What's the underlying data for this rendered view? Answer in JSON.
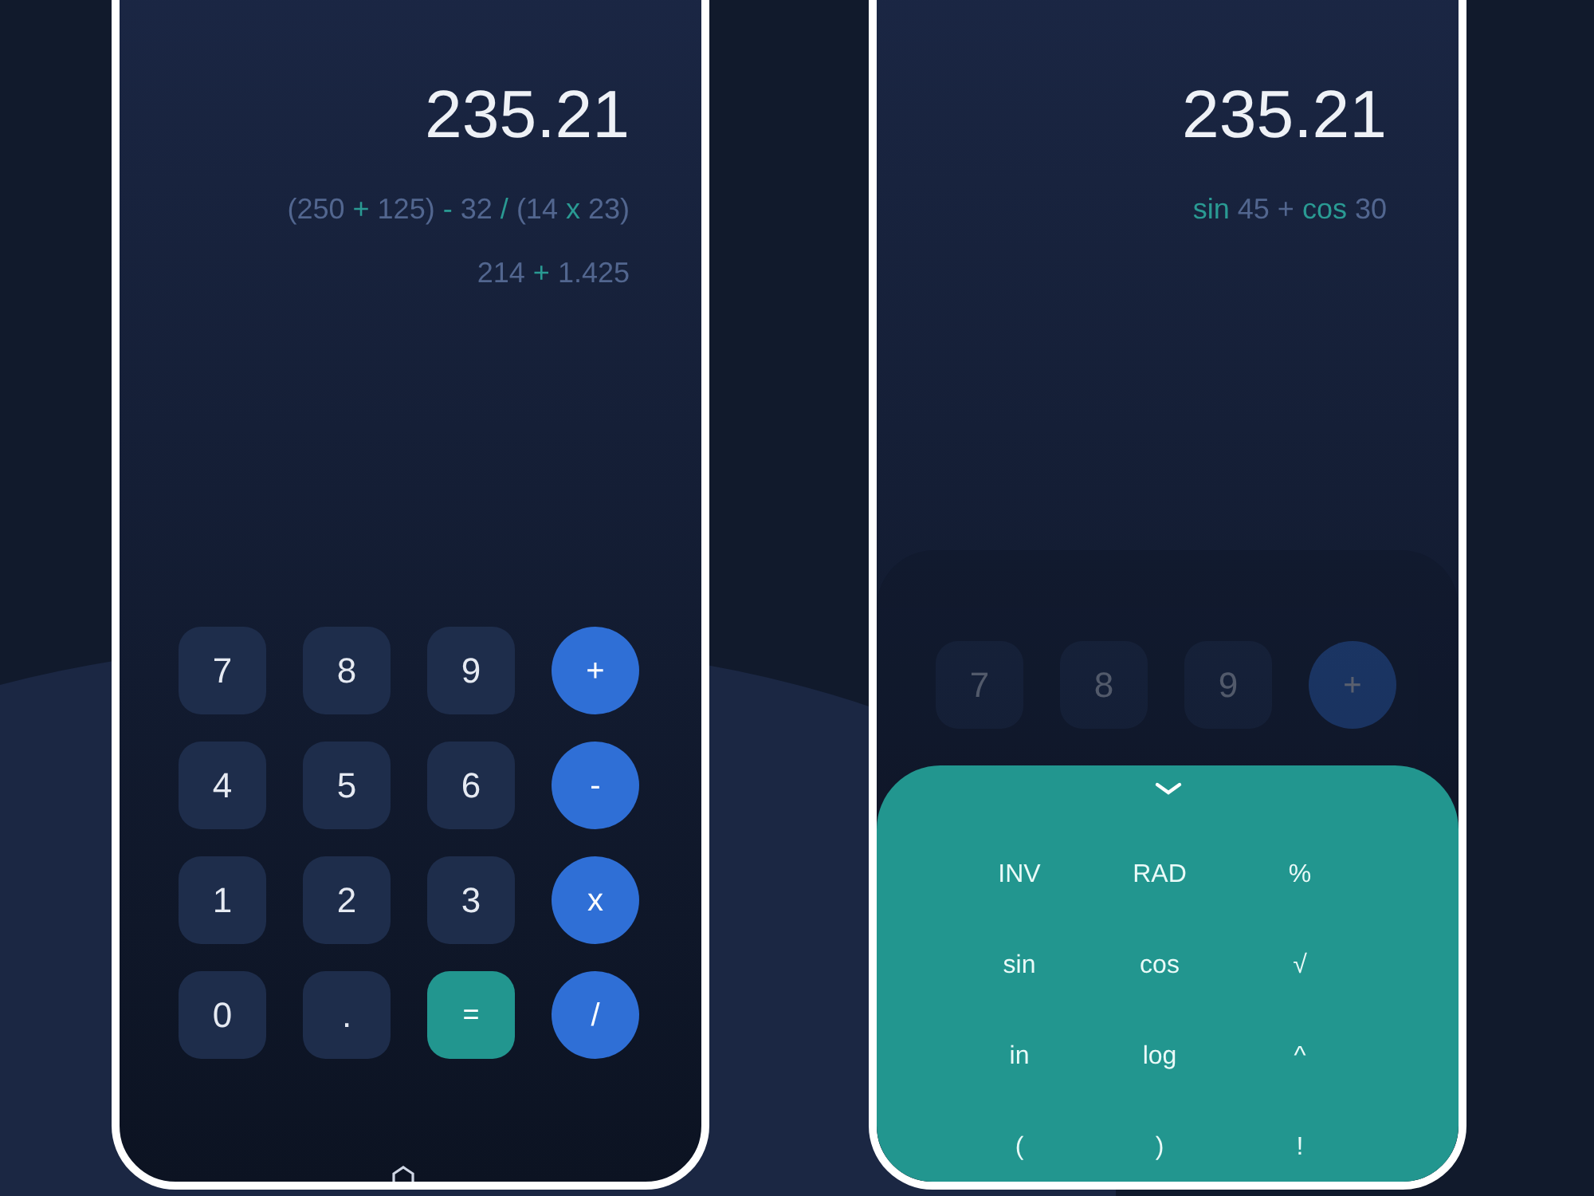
{
  "screens": [
    {
      "result": "235.21",
      "keypad_dimmed": false,
      "expressions": [
        {
          "tokens": [
            {
              "text": "(250",
              "kind": "plain"
            },
            {
              "text": "+",
              "kind": "accent"
            },
            {
              "text": "125)",
              "kind": "plain"
            },
            {
              "text": "-",
              "kind": "accent"
            },
            {
              "text": "32",
              "kind": "plain"
            },
            {
              "text": "/",
              "kind": "accent"
            },
            {
              "text": "(14",
              "kind": "plain"
            },
            {
              "text": "x",
              "kind": "accent"
            },
            {
              "text": "23)",
              "kind": "plain"
            }
          ]
        },
        {
          "tokens": [
            {
              "text": "214",
              "kind": "plain"
            },
            {
              "text": "+",
              "kind": "accent"
            },
            {
              "text": "1.425",
              "kind": "plain"
            }
          ]
        }
      ],
      "keypad": [
        {
          "label": "7",
          "kind": "digit"
        },
        {
          "label": "8",
          "kind": "digit"
        },
        {
          "label": "9",
          "kind": "digit"
        },
        {
          "label": "+",
          "kind": "operator"
        },
        {
          "label": "4",
          "kind": "digit"
        },
        {
          "label": "5",
          "kind": "digit"
        },
        {
          "label": "6",
          "kind": "digit"
        },
        {
          "label": "-",
          "kind": "operator"
        },
        {
          "label": "1",
          "kind": "digit"
        },
        {
          "label": "2",
          "kind": "digit"
        },
        {
          "label": "3",
          "kind": "digit"
        },
        {
          "label": "x",
          "kind": "operator"
        },
        {
          "label": "0",
          "kind": "digit"
        },
        {
          "label": ".",
          "kind": "digit"
        },
        {
          "label": "=",
          "kind": "equals"
        },
        {
          "label": "/",
          "kind": "operator"
        }
      ]
    },
    {
      "result": "235.21",
      "keypad_dimmed": true,
      "expressions": [
        {
          "tokens": [
            {
              "text": "sin",
              "kind": "accent"
            },
            {
              "text": "45",
              "kind": "plain"
            },
            {
              "text": "+",
              "kind": "plain"
            },
            {
              "text": "cos",
              "kind": "accent"
            },
            {
              "text": "30",
              "kind": "plain"
            }
          ]
        }
      ],
      "keypad": [
        {
          "label": "7",
          "kind": "digit"
        },
        {
          "label": "8",
          "kind": "digit"
        },
        {
          "label": "9",
          "kind": "digit"
        },
        {
          "label": "+",
          "kind": "operator"
        }
      ],
      "sheet": {
        "keys": [
          "INV",
          "RAD",
          "%",
          "sin",
          "cos",
          "√",
          "in",
          "log",
          "^",
          "(",
          ")",
          "!"
        ]
      }
    }
  ]
}
